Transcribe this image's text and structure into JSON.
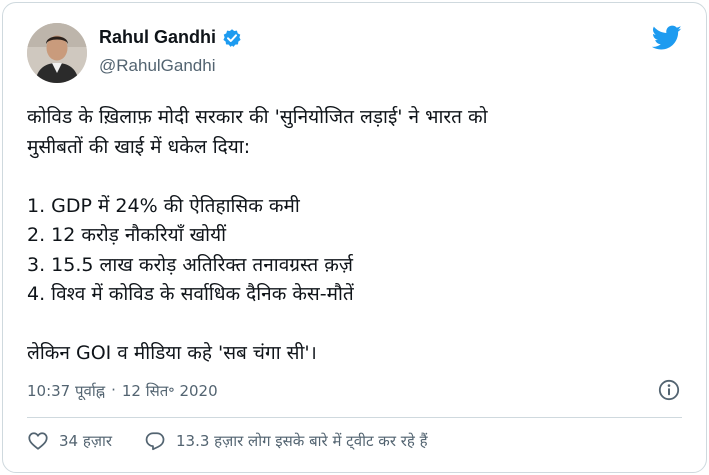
{
  "author": {
    "display_name": "Rahul Gandhi",
    "handle": "@RahulGandhi",
    "verified": true
  },
  "tweet": {
    "lines": [
      "कोविड के ख़िलाफ़ मोदी सरकार की 'सुनियोजित लड़ाई' ने भारत को",
      "मुसीबतों की खाई में धकेल दिया:",
      "",
      "1. GDP में 24% की ऐतिहासिक कमी",
      "2. 12 करोड़ नौकरियाँ खोयीं",
      "3. 15.5 लाख करोड़ अतिरिक्त तनावग्रस्त क़र्ज़",
      "4. विश्व में कोविड के सर्वाधिक दैनिक केस-मौतें",
      "",
      "लेकिन GOI व मीडिया कहे 'सब चंगा सी'।"
    ]
  },
  "meta": {
    "time": "10:37 पूर्वाह्न",
    "separator": "·",
    "date": "12 सित॰ 2020"
  },
  "actions": {
    "likes": "34 हज़ार",
    "discussion": "13.3 हज़ार लोग इसके बारे में ट्वीट कर रहे हैं"
  },
  "colors": {
    "brand": "#1d9bf0",
    "secondary_text": "#536471",
    "border": "#cfd9de"
  },
  "icons": [
    "twitter-bird-icon",
    "verified-badge-icon",
    "info-icon",
    "heart-icon",
    "reply-bubble-icon"
  ]
}
